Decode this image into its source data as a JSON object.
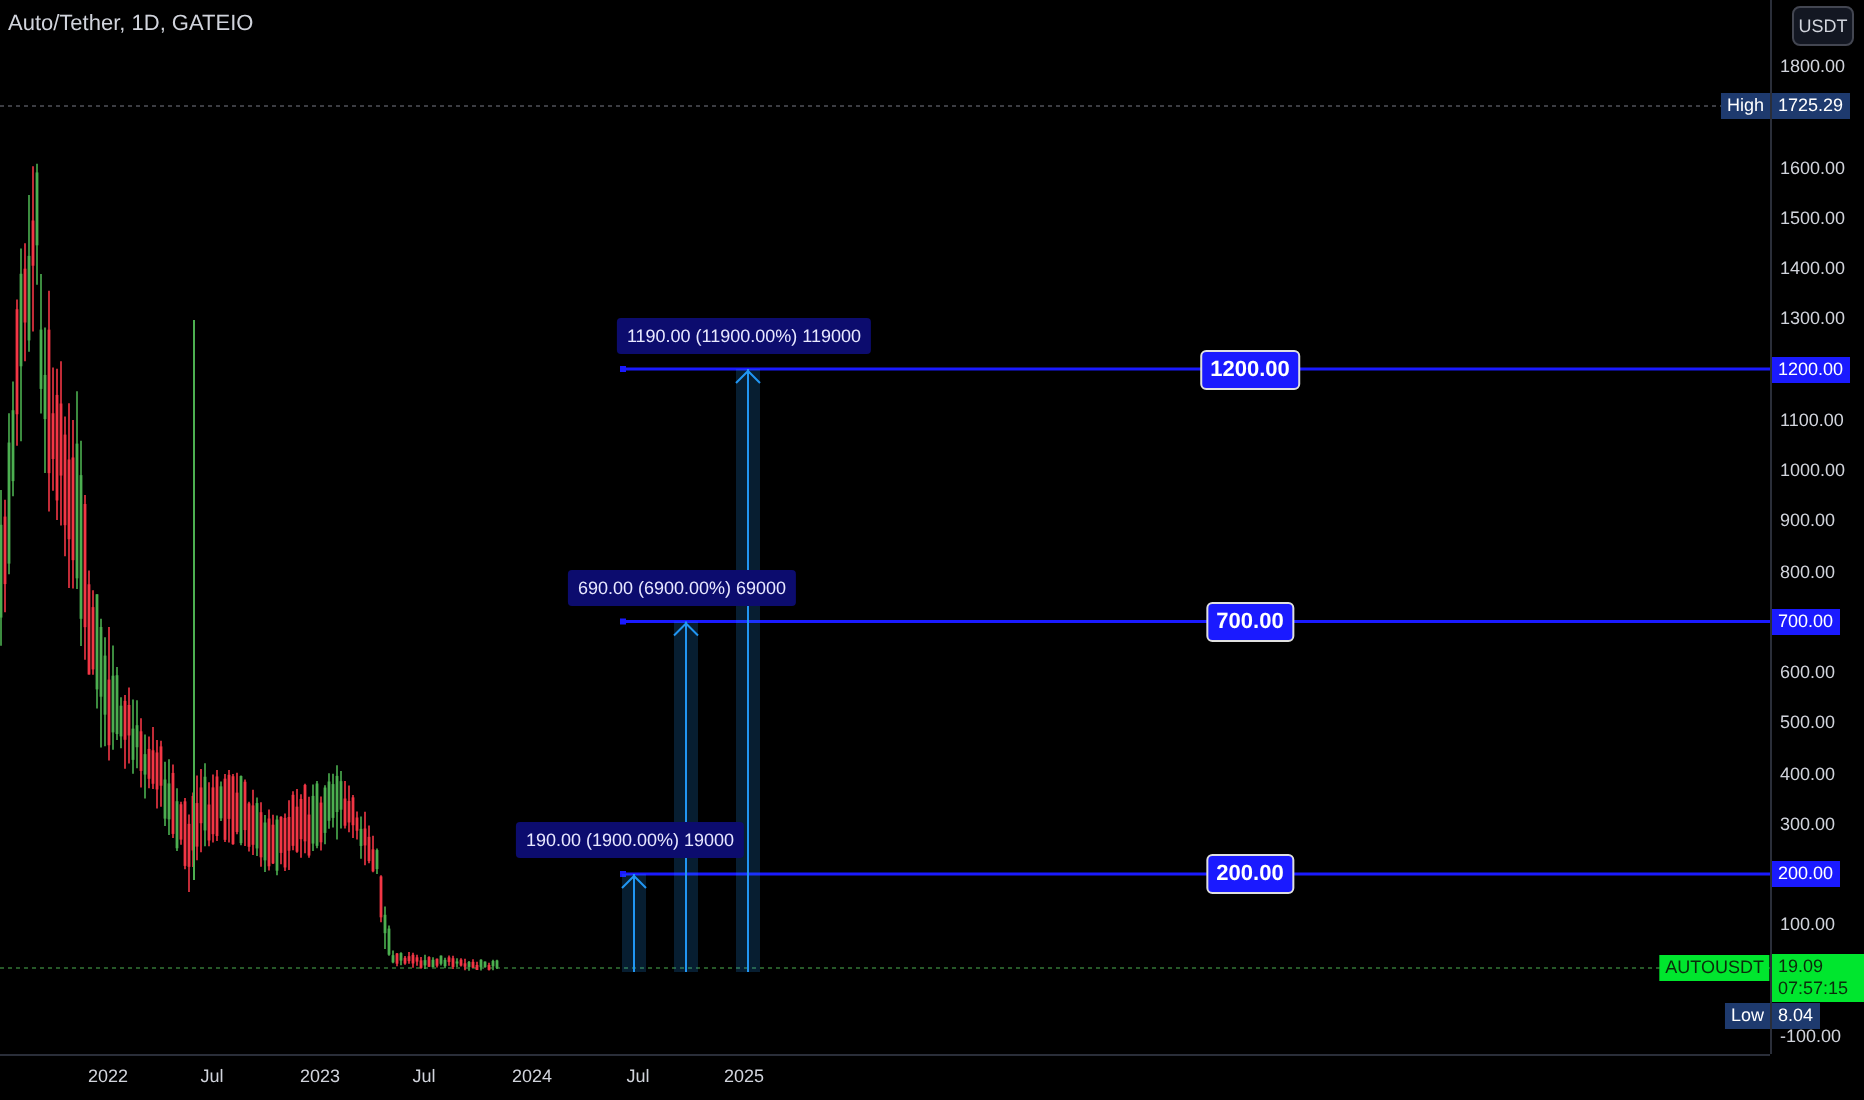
{
  "header": {
    "title": "Auto/Tether, 1D, GATEIO"
  },
  "price_axis": {
    "currency": "USDT",
    "ticks": [
      "1800.00",
      "1600.00",
      "1500.00",
      "1400.00",
      "1300.00",
      "1100.00",
      "1000.00",
      "900.00",
      "800.00",
      "600.00",
      "500.00",
      "400.00",
      "300.00",
      "100.00",
      "-100.00"
    ]
  },
  "high": {
    "label": "High",
    "value": "1725.29"
  },
  "low": {
    "label": "Low",
    "value": "8.04"
  },
  "current": {
    "symbol": "AUTOUSDT",
    "price": "19.09",
    "countdown": "07:57:15"
  },
  "levels": [
    {
      "line_label": "1200.00",
      "axis_label": "1200.00"
    },
    {
      "line_label": "700.00",
      "axis_label": "700.00"
    },
    {
      "line_label": "200.00",
      "axis_label": "200.00"
    }
  ],
  "measurements": [
    {
      "label": "1190.00 (11900.00%) 119000"
    },
    {
      "label": "690.00 (6900.00%) 69000"
    },
    {
      "label": "190.00 (1900.00%) 19000"
    }
  ],
  "time_axis": {
    "labels": [
      "2022",
      "Jul",
      "2023",
      "Jul",
      "2024",
      "Jul",
      "2025"
    ]
  }
}
